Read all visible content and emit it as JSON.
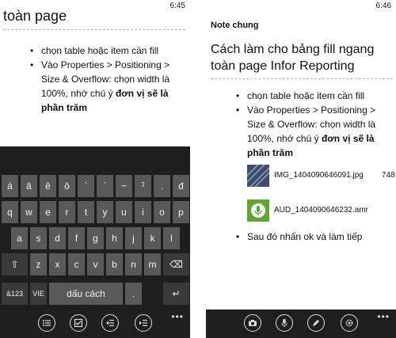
{
  "left": {
    "time": "6:45",
    "title": "toàn page",
    "bullets": [
      {
        "text": "chọn table hoặc item cần fill"
      },
      {
        "lines": [
          "Vào Properties > Positioning >",
          "Size & Overflow: chọn width là",
          "100%, nhớ chú ý "
        ],
        "bold_a": "đơn vị sẽ là",
        "bold_b": "phần trăm"
      }
    ],
    "keyboard": {
      "row1": [
        "à",
        "â",
        "ê",
        "ô",
        "`",
        "ˊ",
        "~",
        "ˀ",
        ".",
        "đ"
      ],
      "row2": [
        "q",
        "w",
        "e",
        "r",
        "t",
        "y",
        "u",
        "i",
        "o",
        "p"
      ],
      "row3": [
        "a",
        "s",
        "d",
        "f",
        "g",
        "h",
        "j",
        "k",
        "l"
      ],
      "row4_shift": "⇧",
      "row4": [
        "z",
        "x",
        "c",
        "v",
        "b",
        "n",
        "m"
      ],
      "backspace": "⌫",
      "symbols": "&123",
      "lang": "VIE",
      "space": "dấu cách",
      "period": ".",
      "enter": "↵"
    },
    "appbar_icons": [
      "list-bullets-icon",
      "checkbox-icon",
      "outdent-icon",
      "indent-icon"
    ],
    "more": "•••"
  },
  "right": {
    "time": "6:46",
    "section": "Note chung",
    "title_lines": [
      "Cách làm cho bảng fill ngang",
      "toàn page Infor Reporting"
    ],
    "bullets": [
      {
        "text": "chọn table hoặc item cần fill"
      },
      {
        "lines": [
          "Vào Properties > Positioning >",
          "Size & Overflow: chọn width là",
          "100%, nhớ chú ý "
        ],
        "bold_a": "đơn vị sẽ là",
        "bold_b": "phần trăm"
      }
    ],
    "attachments": [
      {
        "name": "IMG_1404090646091.jpg",
        "size": "748",
        "type": "image"
      },
      {
        "name": "AUD_1404090646232.amr",
        "size": "",
        "type": "audio"
      }
    ],
    "last_bullet": "Sau đó nhấn ok và làm tiếp",
    "appbar_icons": [
      "camera-icon",
      "microphone-icon",
      "pen-icon",
      "settings-icon"
    ],
    "more": "•••"
  },
  "colors": {
    "audio_green": "#5fa635",
    "keyboard_bg": "#1e1e1e",
    "key": "#595959"
  }
}
